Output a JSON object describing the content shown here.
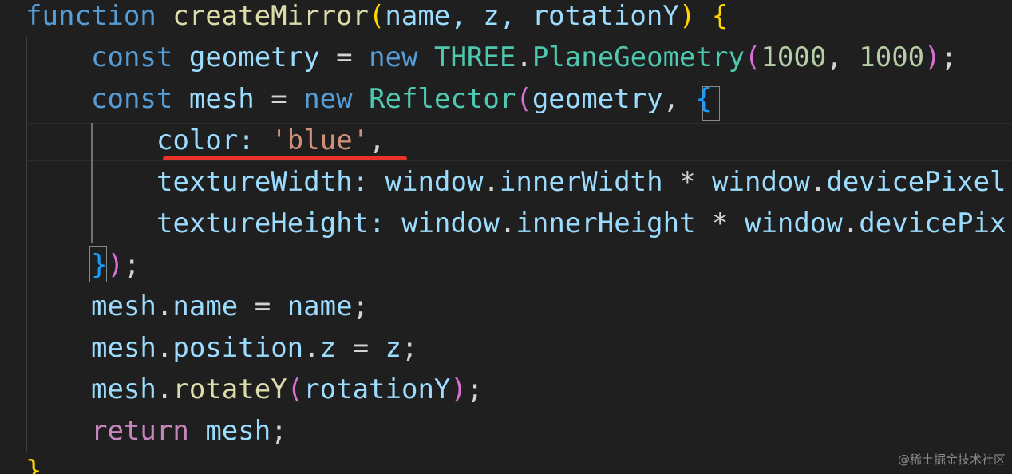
{
  "code": {
    "line1": {
      "kw": "function",
      "name": "createMirror",
      "open": "(",
      "params": "name, z, rotationY",
      "close": ")",
      "brace": "{"
    },
    "line2": {
      "kw": "const",
      "var": "geometry",
      "eq": "=",
      "new": "new",
      "ns": "THREE",
      "dot": ".",
      "cls": "PlaneGeometry",
      "open": "(",
      "n1": "1000",
      "comma": ", ",
      "n2": "1000",
      "close": ")",
      "semi": ";"
    },
    "line3": {
      "kw": "const",
      "var": "mesh",
      "eq": "=",
      "new": "new",
      "cls": "Reflector",
      "open": "(",
      "arg": "geometry",
      "comma": ", ",
      "brace": "{"
    },
    "line4": {
      "key": "color",
      "colon": ": ",
      "str": "'blue'",
      "comma": ","
    },
    "line5": {
      "key": "textureWidth",
      "colon": ": ",
      "a": "window",
      "dot1": ".",
      "b": "innerWidth",
      "op": " * ",
      "c": "window",
      "dot2": ".",
      "d": "devicePixel"
    },
    "line6": {
      "key": "textureHeight",
      "colon": ": ",
      "a": "window",
      "dot1": ".",
      "b": "innerHeight",
      "op": " * ",
      "c": "window",
      "dot2": ".",
      "d": "devicePix"
    },
    "line7": {
      "brace": "}",
      "paren": ")",
      "semi": ";"
    },
    "line8": {
      "obj": "mesh",
      "dot": ".",
      "prop": "name",
      "eq": " = ",
      "val": "name",
      "semi": ";"
    },
    "line9": {
      "obj": "mesh",
      "dot": ".",
      "prop": "position",
      "dot2": ".",
      "prop2": "z",
      "eq": " = ",
      "val": "z",
      "semi": ";"
    },
    "line10": {
      "obj": "mesh",
      "dot": ".",
      "fn": "rotateY",
      "open": "(",
      "arg": "rotationY",
      "close": ")",
      "semi": ";"
    },
    "line11": {
      "kw": "return",
      "val": "mesh",
      "semi": ";"
    },
    "line12": {
      "brace": "}"
    }
  },
  "watermark": "@稀土掘金技术社区",
  "colors": {
    "background": "#1f1f1f",
    "keyword": "#569cd6",
    "control": "#c586c0",
    "function": "#dcdcaa",
    "variable": "#9cdcfe",
    "class": "#4ec9b0",
    "number": "#b5cea8",
    "string": "#ce9178",
    "underline": "#e8322a"
  }
}
